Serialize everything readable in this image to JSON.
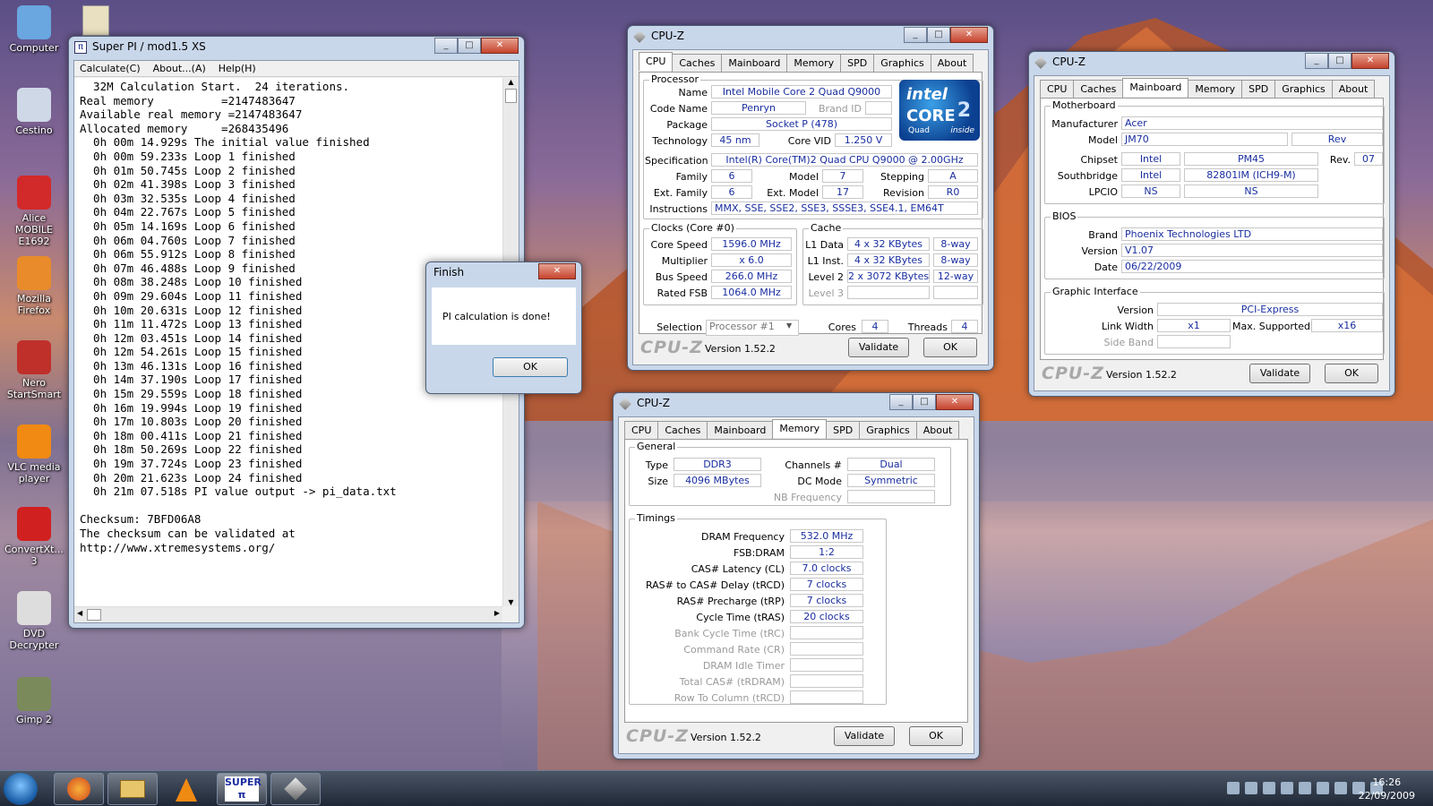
{
  "desktop_icons": [
    {
      "label": "Computer"
    },
    {
      "label": "Cestino"
    },
    {
      "label": "Alice MOBILE E1692"
    },
    {
      "label": "Mozilla Firefox"
    },
    {
      "label": "Nero StartSmart"
    },
    {
      "label": "VLC media player"
    },
    {
      "label": "ConvertXt... 3"
    },
    {
      "label": "DVD Decrypter"
    },
    {
      "label": "Gimp 2"
    }
  ],
  "superpi": {
    "title": "Super PI / mod1.5 XS",
    "menu": [
      "Calculate(C)",
      "About...(A)",
      "Help(H)"
    ],
    "lines": [
      "  32M Calculation Start.  24 iterations.",
      "Real memory          =2147483647",
      "Available real memory =2147483647",
      "Allocated memory     =268435496",
      "  0h 00m 14.929s The initial value finished",
      "  0h 00m 59.233s Loop 1 finished",
      "  0h 01m 50.745s Loop 2 finished",
      "  0h 02m 41.398s Loop 3 finished",
      "  0h 03m 32.535s Loop 4 finished",
      "  0h 04m 22.767s Loop 5 finished",
      "  0h 05m 14.169s Loop 6 finished",
      "  0h 06m 04.760s Loop 7 finished",
      "  0h 06m 55.912s Loop 8 finished",
      "  0h 07m 46.488s Loop 9 finished",
      "  0h 08m 38.248s Loop 10 finished",
      "  0h 09m 29.604s Loop 11 finished",
      "  0h 10m 20.631s Loop 12 finished",
      "  0h 11m 11.472s Loop 13 finished",
      "  0h 12m 03.451s Loop 14 finished",
      "  0h 12m 54.261s Loop 15 finished",
      "  0h 13m 46.131s Loop 16 finished",
      "  0h 14m 37.190s Loop 17 finished",
      "  0h 15m 29.559s Loop 18 finished",
      "  0h 16m 19.994s Loop 19 finished",
      "  0h 17m 10.803s Loop 20 finished",
      "  0h 18m 00.411s Loop 21 finished",
      "  0h 18m 50.269s Loop 22 finished",
      "  0h 19m 37.724s Loop 23 finished",
      "  0h 20m 21.623s Loop 24 finished",
      "  0h 21m 07.518s PI value output -> pi_data.txt",
      "",
      "Checksum: 7BFD06A8",
      "The checksum can be validated at",
      "http://www.xtremesystems.org/"
    ]
  },
  "finish_dialog": {
    "title": "Finish",
    "message": "PI calculation is done!",
    "ok": "OK"
  },
  "cpuz_tabs": [
    "CPU",
    "Caches",
    "Mainboard",
    "Memory",
    "SPD",
    "Graphics",
    "About"
  ],
  "cpuz_common": {
    "title": "CPU-Z",
    "logo": "CPU-Z",
    "version": "Version 1.52.2",
    "validate": "Validate",
    "ok": "OK"
  },
  "cpu": {
    "g_processor": "Processor",
    "l_name": "Name",
    "name": "Intel Mobile Core 2 Quad Q9000",
    "l_code": "Code Name",
    "code": "Penryn",
    "l_brand": "Brand ID",
    "brand": "",
    "l_package": "Package",
    "package": "Socket P (478)",
    "l_tech": "Technology",
    "tech": "45 nm",
    "l_vid": "Core VID",
    "vid": "1.250 V",
    "l_spec": "Specification",
    "spec": "Intel(R) Core(TM)2 Quad  CPU   Q9000  @ 2.00GHz",
    "l_family": "Family",
    "family": "6",
    "l_model": "Model",
    "model": "7",
    "l_stepping": "Stepping",
    "stepping": "A",
    "l_extfam": "Ext. Family",
    "extfam": "6",
    "l_extmodel": "Ext. Model",
    "extmodel": "17",
    "l_rev": "Revision",
    "rev": "R0",
    "l_instr": "Instructions",
    "instr": "MMX, SSE, SSE2, SSE3, SSSE3, SSE4.1, EM64T",
    "g_clocks": "Clocks (Core #0)",
    "l_cs": "Core Speed",
    "cs": "1596.0 MHz",
    "l_mult": "Multiplier",
    "mult": "x 6.0",
    "l_bus": "Bus Speed",
    "bus": "266.0 MHz",
    "l_fsb": "Rated FSB",
    "fsb": "1064.0 MHz",
    "g_cache": "Cache",
    "l_l1d": "L1 Data",
    "l1d": "4 x 32 KBytes",
    "l1d_w": "8-way",
    "l_l1i": "L1 Inst.",
    "l1i": "4 x 32 KBytes",
    "l1i_w": "8-way",
    "l_l2": "Level 2",
    "l2": "2 x 3072 KBytes",
    "l2_w": "12-way",
    "l_l3": "Level 3",
    "l_sel": "Selection",
    "sel": "Processor #1",
    "l_cores": "Cores",
    "cores": "4",
    "l_threads": "Threads",
    "threads": "4",
    "intel": {
      "brand": "intel",
      "line": "CORE",
      "sub": "Quad",
      "inside": "inside",
      "num": "2"
    }
  },
  "mainboard": {
    "g_mb": "Motherboard",
    "l_man": "Manufacturer",
    "man": "Acer",
    "l_model": "Model",
    "model": "JM70",
    "rev_lbl": "Rev",
    "l_chip": "Chipset",
    "chip_v": "Intel",
    "chip_m": "PM45",
    "l_rev": "Rev.",
    "rev": "07",
    "l_south": "Southbridge",
    "south_v": "Intel",
    "south_m": "82801IM (ICH9-M)",
    "l_lpcio": "LPCIO",
    "lpcio_v": "NS",
    "lpcio_m": "NS",
    "g_bios": "BIOS",
    "l_brand": "Brand",
    "brand": "Phoenix Technologies LTD",
    "l_ver": "Version",
    "ver": "V1.07",
    "l_date": "Date",
    "date": "06/22/2009",
    "g_gi": "Graphic Interface",
    "l_giver": "Version",
    "giver": "PCI-Express",
    "l_lw": "Link Width",
    "lw": "x1",
    "l_ms": "Max. Supported",
    "ms": "x16",
    "l_sb": "Side Band"
  },
  "memory": {
    "g_gen": "General",
    "l_type": "Type",
    "type": "DDR3",
    "l_ch": "Channels #",
    "ch": "Dual",
    "l_size": "Size",
    "size": "4096 MBytes",
    "l_dc": "DC Mode",
    "dc": "Symmetric",
    "l_nb": "NB Frequency",
    "g_tim": "Timings",
    "l_dram": "DRAM Frequency",
    "dram": "532.0 MHz",
    "l_fsbdram": "FSB:DRAM",
    "fsbdram": "1:2",
    "l_cl": "CAS# Latency (CL)",
    "cl": "7.0 clocks",
    "l_rcd": "RAS# to CAS# Delay (tRCD)",
    "rcd": "7 clocks",
    "l_rp": "RAS# Precharge (tRP)",
    "rp": "7 clocks",
    "l_ras": "Cycle Time (tRAS)",
    "ras": "20 clocks",
    "l_rc": "Bank Cycle Time (tRC)",
    "l_cr": "Command Rate (CR)",
    "l_idle": "DRAM Idle Timer",
    "l_rdram": "Total CAS# (tRDRAM)",
    "l_rtc": "Row To Column (tRCD)"
  },
  "taskbar": {
    "time": "16:26",
    "date": "22/09/2009",
    "superpi_label": "SUPER"
  }
}
